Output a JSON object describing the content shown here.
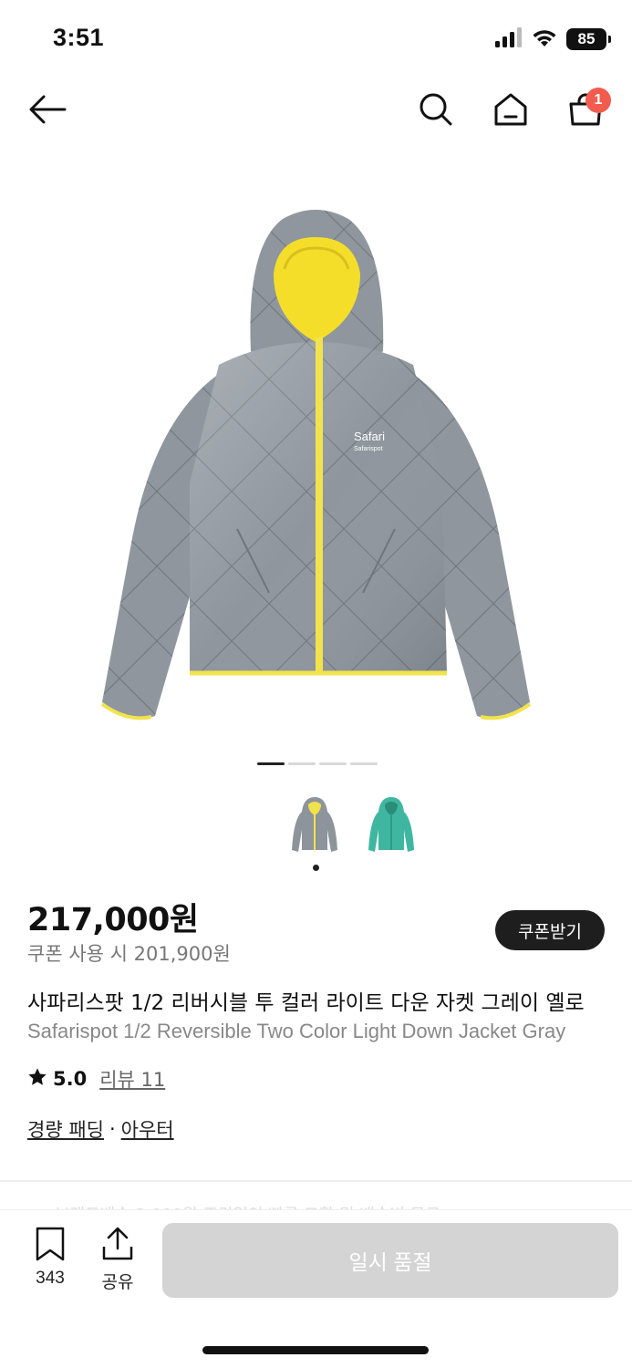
{
  "status_bar": {
    "time": "3:51",
    "battery": "85",
    "icons": [
      "cellular-signal-icon",
      "wifi-icon",
      "battery-icon"
    ]
  },
  "nav": {
    "icons": [
      "back-arrow-icon",
      "search-icon",
      "home-icon",
      "shopping-bag-icon"
    ],
    "cart_count": "1",
    "badge_color": "#f25c4e"
  },
  "gallery": {
    "page_count": 4,
    "current_page": 1,
    "colors": [
      {
        "name": "gray",
        "body": "#8e949c",
        "accent": "#f0e24a"
      },
      {
        "name": "mint",
        "body": "#3fb7a0",
        "accent": "#3fb7a0"
      }
    ],
    "selected_color": 0,
    "logo_text_1": "Safari",
    "logo_text_2": "Safarispot"
  },
  "product": {
    "price": "217,000원",
    "coupon_price": "쿠폰 사용 시 201,900원",
    "coupon_button": "쿠폰받기",
    "title_ko": "사파리스팟 1/2 리버시블 투 컬러 라이트 다운 자켓 그레이 옐로",
    "title_en": "Safarispot 1/2 Reversible Two Color Light Down Jacket Gray",
    "rating": "5.0",
    "review_link": "리뷰 11",
    "category_1": "경량 패딩",
    "category_sep": "·",
    "category_2": "아우터"
  },
  "hidden_strip_text": "브랜드배송 3,000원 조건없이 빠른 교환 및 배송비 무료",
  "bottom_bar": {
    "bookmark_count": "343",
    "share_label": "공유",
    "soldout_label": "일시 품절",
    "soldout_color": "#d4d4d4"
  }
}
